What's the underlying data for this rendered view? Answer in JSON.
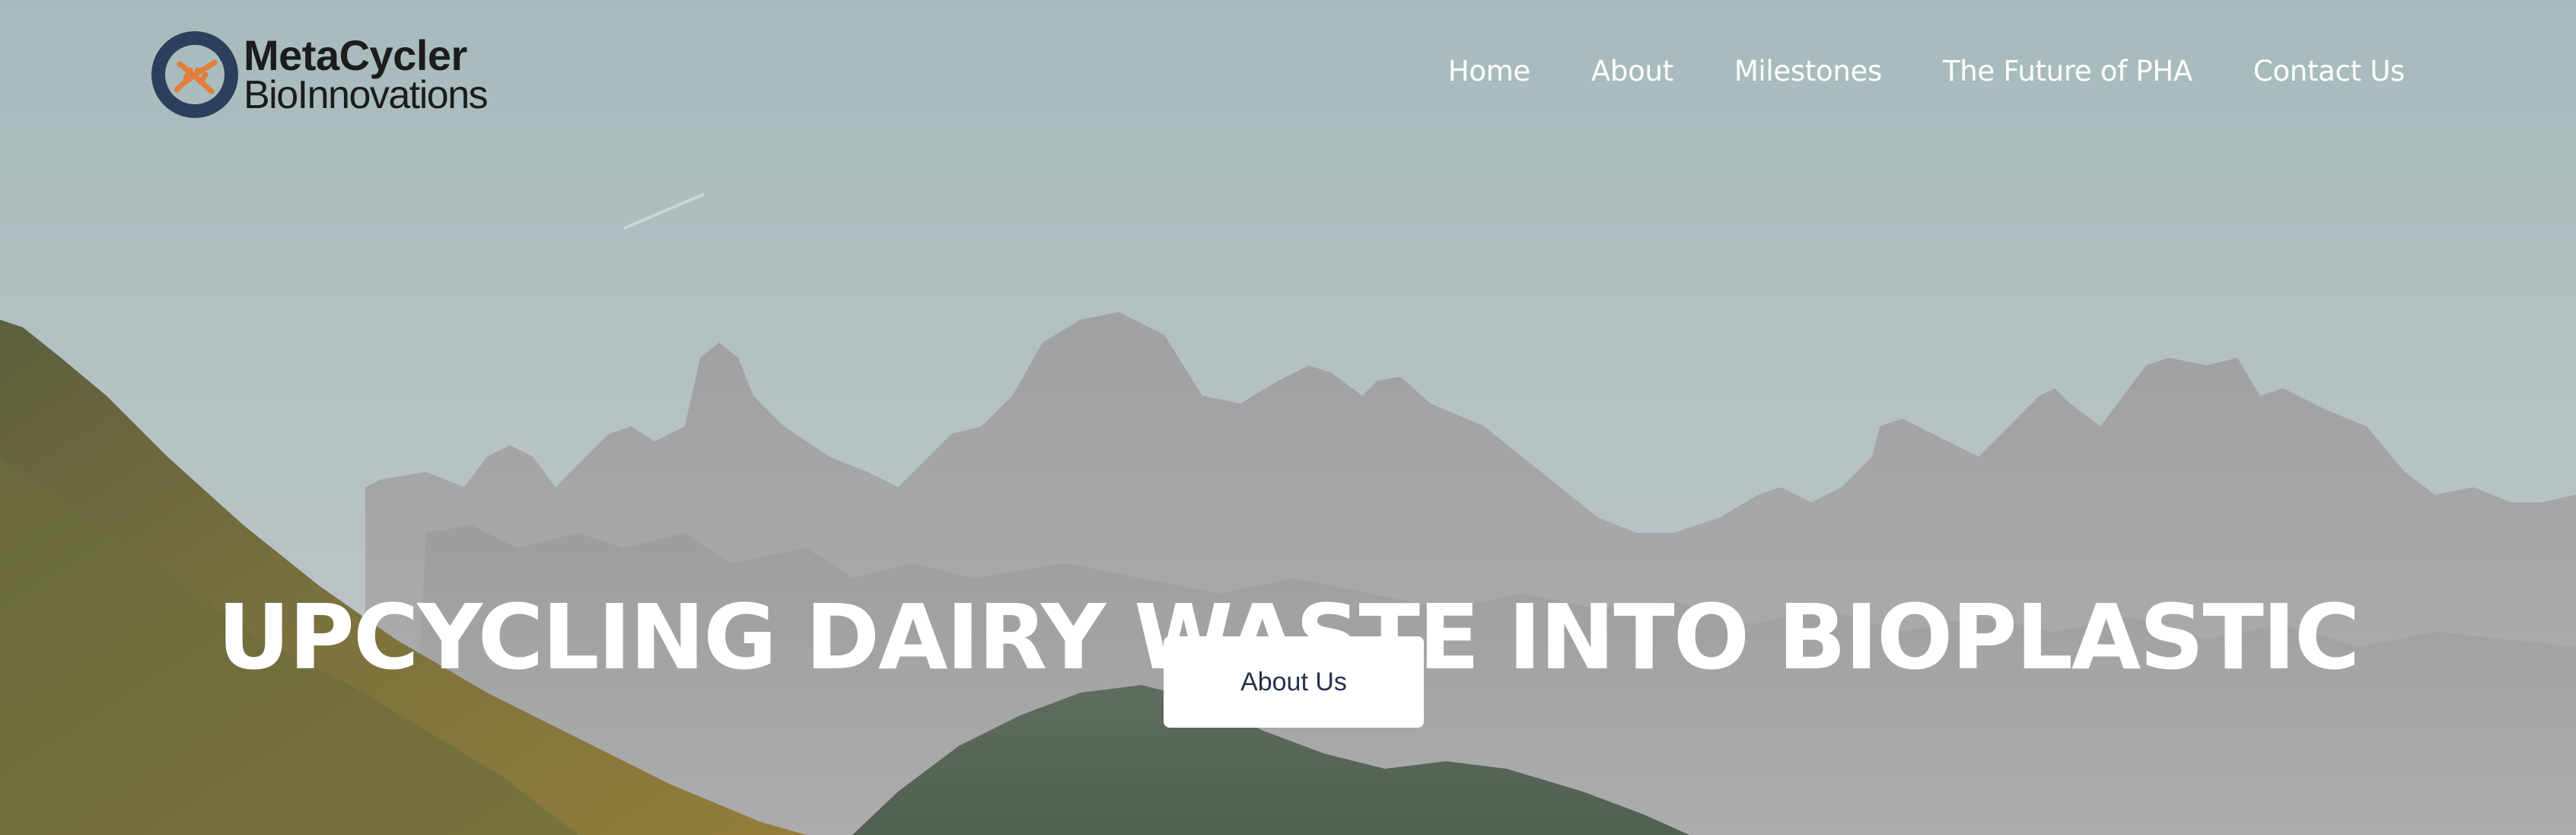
{
  "brand": {
    "name_line1": "MetaCycler",
    "name_line2": "BioInnovations",
    "logo_ring_color": "#2c3f5c",
    "logo_helix_color": "#e27d3c"
  },
  "nav": {
    "items": [
      {
        "label": "Home"
      },
      {
        "label": "About"
      },
      {
        "label": "Milestones"
      },
      {
        "label": "The Future of PHA"
      },
      {
        "label": "Contact Us"
      }
    ]
  },
  "hero": {
    "headline": "UPCYCLING DAIRY WASTE INTO BIOPLASTIC",
    "cta_label": "About Us",
    "background": "mountain-landscape-image",
    "cta_text_color": "#23324c"
  }
}
